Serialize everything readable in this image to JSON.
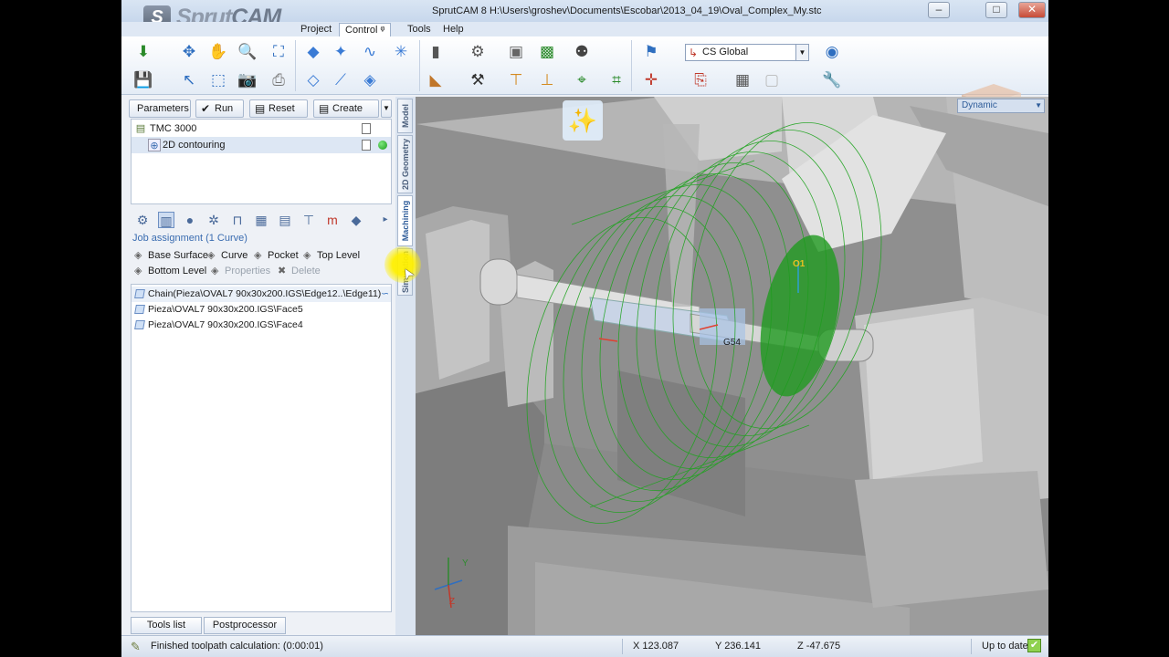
{
  "window": {
    "title": "SprutCAM 8   H:\\Users\\groshev\\Documents\\Escobar\\2013_04_19\\Oval_Complex_My.stc",
    "logo_badge": "S",
    "logo_text_a": "Sprut",
    "logo_text_b": "CAM",
    "min_glyph": "–",
    "max_glyph": "□",
    "close_glyph": "✕"
  },
  "menu": {
    "project": "Project",
    "control": "Control",
    "control_pin": "ᵠ",
    "tools": "Tools",
    "help": "Help"
  },
  "toolbar": {
    "cs_selected": "CS Global",
    "cs_icon_glyph": "↳",
    "dropdown_glyph": "▼"
  },
  "op_toolbar": {
    "parameters": "Parameters",
    "run": "Run",
    "run_icon": "✔",
    "reset": "Reset",
    "reset_icon": "▤",
    "create": "Create",
    "create_icon": "▤",
    "create_dd": "▼"
  },
  "op_tree": {
    "machine": "TMC 3000",
    "machine_icon": "▤",
    "operation": "2D contouring",
    "operation_icon": "⊕"
  },
  "job": {
    "title": "Job assignment (1 Curve)",
    "base_surface": "Base Surface",
    "curve": "Curve",
    "pocket": "Pocket",
    "top_level": "Top Level",
    "bottom_level": "Bottom Level",
    "properties": "Properties",
    "delete": "Delete",
    "icon_shape": "◈",
    "icon_delete": "✖",
    "items": [
      "Chain(Pieza\\OVAL7 90x30x200.IGS\\Edge12..\\Edge11)",
      "Pieza\\OVAL7 90x30x200.IGS\\Face5",
      "Pieza\\OVAL7 90x30x200.IGS\\Face4"
    ],
    "chain_badge": "∽"
  },
  "strip_icons": {
    "first": "⚙",
    "second": "▥",
    "third": "●",
    "fourth": "✲",
    "fifth": "⊓",
    "sixth": "▦",
    "seventh": "▤",
    "eighth": "⊤",
    "ninth": "m",
    "tenth": "◆",
    "more": "▸"
  },
  "bottom_tabs": {
    "tools_list": "Tools list",
    "postprocessor": "Postprocessor"
  },
  "vertical_tabs": {
    "model": "Model",
    "geometry": "2D Geometry",
    "machining": "Machining",
    "simulation": "Simulation"
  },
  "viewport": {
    "mode": "Dynamic",
    "mode_arrow": "▼",
    "wand_glyph": "✨",
    "label_g54": "G54",
    "label_o1": "O1",
    "axis_y": "Y",
    "axis_z": "Z"
  },
  "cursor_glyph": "➤",
  "status": {
    "icon": "✎",
    "message": "Finished toolpath calculation: (0:00:01)",
    "x": "X 123.087",
    "y": "Y 236.141",
    "z": "Z -47.675",
    "up_to_date": "Up to date",
    "check": "✔"
  },
  "colors": {
    "accent": "#3a6cb0",
    "toolpath_green": "#1fa31f",
    "machine_gray": "#a8a8a8",
    "ok_green": "#8fd14f"
  }
}
